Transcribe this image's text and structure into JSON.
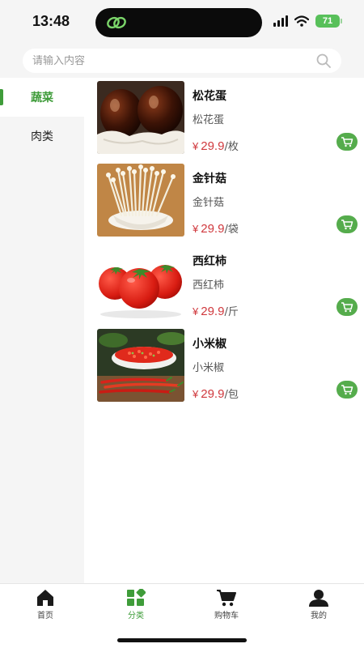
{
  "status": {
    "time": "13:48",
    "battery": "71"
  },
  "search": {
    "placeholder": "请输入内容"
  },
  "sidebar": {
    "items": [
      {
        "label": "蔬菜",
        "active": true
      },
      {
        "label": "肉类",
        "active": false
      }
    ]
  },
  "products": [
    {
      "name": "松花蛋",
      "sub": "松花蛋",
      "currency": "¥",
      "price": "29.9",
      "unit": "/枚"
    },
    {
      "name": "金针菇",
      "sub": "金针菇",
      "currency": "¥",
      "price": "29.9",
      "unit": "/袋"
    },
    {
      "name": "西红柿",
      "sub": "西红柿",
      "currency": "¥",
      "price": "29.9",
      "unit": "/斤"
    },
    {
      "name": "小米椒",
      "sub": "小米椒",
      "currency": "¥",
      "price": "29.9",
      "unit": "/包"
    }
  ],
  "tabs": [
    {
      "label": "首页",
      "icon": "home-icon"
    },
    {
      "label": "分类",
      "icon": "category-icon",
      "active": true
    },
    {
      "label": "购物车",
      "icon": "cart-icon"
    },
    {
      "label": "我的",
      "icon": "profile-icon"
    }
  ],
  "colors": {
    "accent": "#3f9c3a",
    "price": "#d0393e",
    "cart_button": "#55ac4c",
    "battery": "#58c05a"
  }
}
